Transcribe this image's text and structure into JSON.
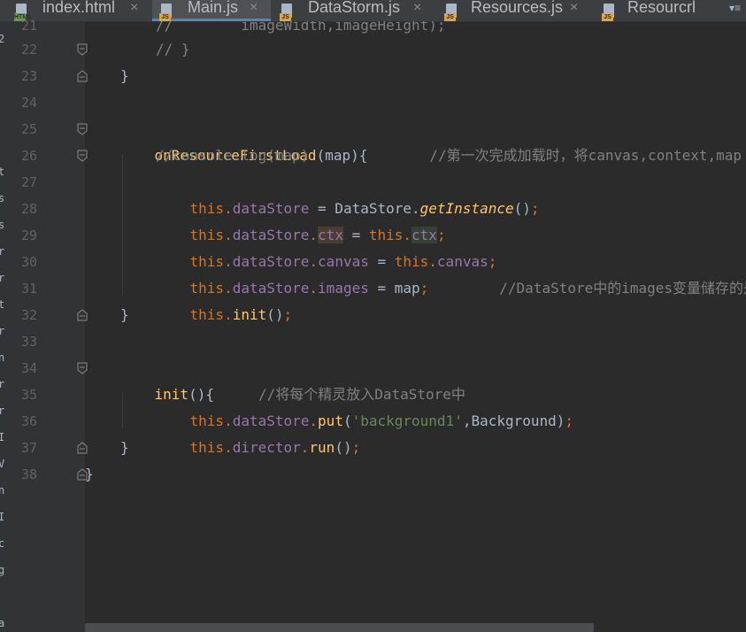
{
  "tabs": [
    {
      "type": "HTML",
      "name": "index.html",
      "close": "×",
      "active": false
    },
    {
      "type": "JS",
      "name": "Main.js",
      "close": "×",
      "active": true
    },
    {
      "type": "JS",
      "name": "DataStorm.js",
      "close": "×",
      "active": false
    },
    {
      "type": "JS",
      "name": "Resources.js",
      "close": "×",
      "active": false
    },
    {
      "type": "JS",
      "name": "Resourcrl",
      "close": "×",
      "active": false
    }
  ],
  "tab_overflow": "▾≡",
  "line_numbers": [
    "21",
    "22",
    "23",
    "24",
    "25",
    "26",
    "27",
    "28",
    "29",
    "30",
    "31",
    "32",
    "33",
    "34",
    "35",
    "36",
    "37",
    "38"
  ],
  "code": {
    "l21": "//        imageWidth,imageHeight);",
    "l22": "// }",
    "l23": "}",
    "l25": {
      "fn": "onResourceFirstLoad",
      "rest": "(map){",
      "comment": "//第一次完成加载时，将canvas,context,map"
    },
    "l26": "//console.log(map)",
    "l27": {
      "this": "this",
      "dot1": ".",
      "field": "dataStore",
      "mid": " = DataStore.",
      "call": "getInstance",
      "end": "()",
      "semi": ";"
    },
    "l28": {
      "this": "this",
      "dot1": ".",
      "field": "dataStore",
      "dot2": ".",
      "f2": "ctx",
      "eq": " = ",
      "this2": "this",
      "dot3": ".",
      "f3": "ctx",
      "semi": ";"
    },
    "l29": {
      "this": "this",
      "dot1": ".",
      "field": "dataStore",
      "dot2": ".",
      "f2": "canvas",
      "eq": " = ",
      "this2": "this",
      "dot3": ".",
      "f3": "canvas",
      "semi": ";"
    },
    "l30": {
      "this": "this",
      "dot1": ".",
      "field": "dataStore",
      "dot2": ".",
      "f2": "images",
      "eq": " = map",
      "semi": ";",
      "comment": "//DataStore中的images变量储存的是"
    },
    "l31": {
      "this": "this",
      "dot1": ".",
      "fn": "init",
      "end": "()",
      "semi": ";"
    },
    "l32": "}",
    "l34": {
      "fn": "init",
      "rest": "(){",
      "comment": "//将每个精灵放入DataStore中"
    },
    "l35": {
      "this": "this",
      "dot1": ".",
      "field": "dataStore",
      "dot2": ".",
      "fn": "put",
      "open": "(",
      "str": "'background1'",
      "rest": ",Background)",
      "semi": ";"
    },
    "l36": {
      "this": "this",
      "dot1": ".",
      "field": "director",
      "dot2": ".",
      "fn": "run",
      "end": "()",
      "semi": ";"
    },
    "l37": "}",
    "l38": "}"
  },
  "left_strip_chars": [
    "2",
    "t",
    "s",
    "s",
    "r",
    "r",
    "t",
    "r",
    "n",
    "r",
    "r",
    "I",
    "V",
    "n",
    "I",
    "c",
    "g",
    "a"
  ],
  "colors": {
    "background": "#2b2b2b",
    "gutter": "#313335",
    "keyword": "#cc7832",
    "function": "#ffc66d",
    "field": "#9876aa",
    "string": "#6a8759",
    "comment": "#808080",
    "text": "#a9b7c6",
    "active_tab_underline": "#4a88c7"
  }
}
